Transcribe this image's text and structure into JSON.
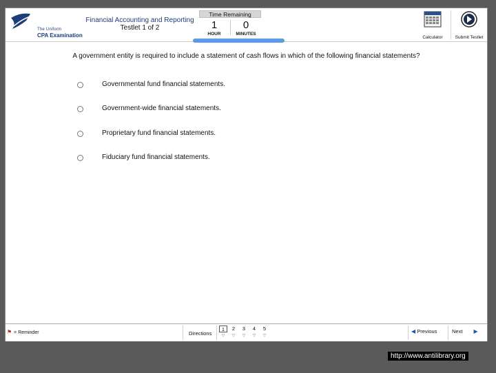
{
  "header": {
    "logo_line1": "The Uniform",
    "logo_line2": "CPA Examination",
    "exam_section": "Financial Accounting and Reporting",
    "testlet": "Testlet 1 of 2"
  },
  "timer": {
    "title": "Time Remaining",
    "hours": "1",
    "hours_label": "HOUR",
    "minutes": "0",
    "minutes_label": "MINUTES"
  },
  "tools": {
    "calculator_label": "Calculator",
    "submit_label": "Submit Testlet"
  },
  "question": {
    "text": "A government entity is required to include a statement of cash flows in which of the following financial statements?",
    "options": [
      "Governmental fund financial statements.",
      "Government-wide financial statements.",
      "Proprietary fund financial statements.",
      "Fiduciary fund financial statements."
    ]
  },
  "footer": {
    "reminder_label": "= Reminder",
    "directions_label": "Directions",
    "questions": [
      "1",
      "2",
      "3",
      "4",
      "5"
    ],
    "current_question": "1",
    "previous_label": "Previous",
    "next_label": "Next"
  },
  "watermark": "http://www.antilibrary.org",
  "colors": {
    "brand": "#1e3d7b",
    "nav_arrow": "#1e5aa8",
    "highlight": "#4a90e2"
  }
}
